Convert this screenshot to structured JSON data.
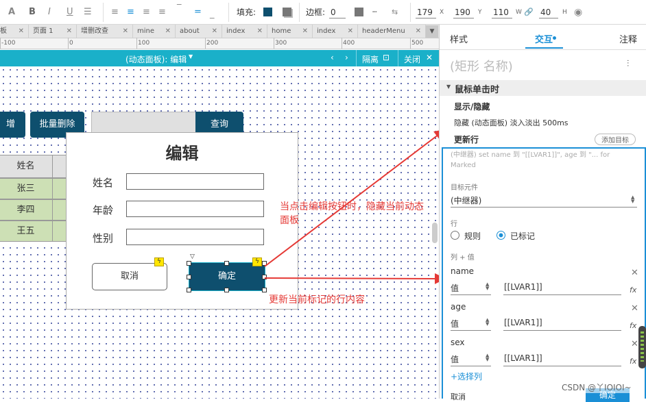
{
  "toolbar": {
    "fill_label": "填充:",
    "border_label": "边框:",
    "border_value": "0",
    "x_value": "179",
    "x_unit": "X",
    "y_value": "190",
    "y_unit": "Y",
    "w_value": "110",
    "w_unit": "W",
    "h_value": "40",
    "h_unit": "H",
    "fill_color": "#0e4f6e",
    "accent_color": "#1ab0c9"
  },
  "tabs": [
    {
      "label": "板"
    },
    {
      "label": "页面 1"
    },
    {
      "label": "增删改查"
    },
    {
      "label": "mine"
    },
    {
      "label": "about"
    },
    {
      "label": "index"
    },
    {
      "label": "home"
    },
    {
      "label": "index"
    },
    {
      "label": "headerMenu"
    }
  ],
  "ruler": {
    "labels": [
      "-100",
      "0",
      "100",
      "200",
      "300",
      "400",
      "500"
    ]
  },
  "panel_bar": {
    "title": "(动态面板): 编辑",
    "isolate_label": "隔离",
    "close_label": "关闭"
  },
  "canvas": {
    "add_button": "增",
    "batch_delete_button": "批量删除",
    "query_button": "查询",
    "table_header": "姓名",
    "table_rows": [
      "张三",
      "李四",
      "王五"
    ],
    "dialog": {
      "title": "编辑",
      "name_label": "姓名",
      "age_label": "年龄",
      "gender_label": "性别",
      "cancel_button": "取消",
      "confirm_button": "确定"
    },
    "annotation_1": "当点击编辑按钮时，隐藏当前动态面板",
    "annotation_2": "更新当前标记的行内容"
  },
  "right_panel": {
    "tab_style": "样式",
    "tab_interaction": "交互",
    "tab_notes": "注释",
    "shape_name_placeholder": "(矩形 名称)",
    "event_title": "鼠标单击时",
    "action_show_hide": "显示/隐藏",
    "action_detail": "隐藏 (动态面板) 淡入淡出 500ms",
    "action_update_row": "更新行",
    "add_target_button": "添加目标",
    "repeater_summary": "(中继器) set name 到 \"[[LVAR1]]\", age 到 \"... for Marked",
    "target_label": "目标元件",
    "target_value": "(中继器)",
    "row_label": "行",
    "radio_rule": "规则",
    "radio_marked": "已标记",
    "col_value_label": "列 + 值",
    "columns": [
      {
        "name": "name",
        "type": "值",
        "value": "[[LVAR1]]"
      },
      {
        "name": "age",
        "type": "值",
        "value": "[[LVAR1]]"
      },
      {
        "name": "sex",
        "type": "值",
        "value": "[[LVAR1]]"
      }
    ],
    "select_column": "+选择列",
    "footer_hint": "取消",
    "confirm_partial": "确定",
    "watermark": "CSDN @丫IOIOI~"
  }
}
